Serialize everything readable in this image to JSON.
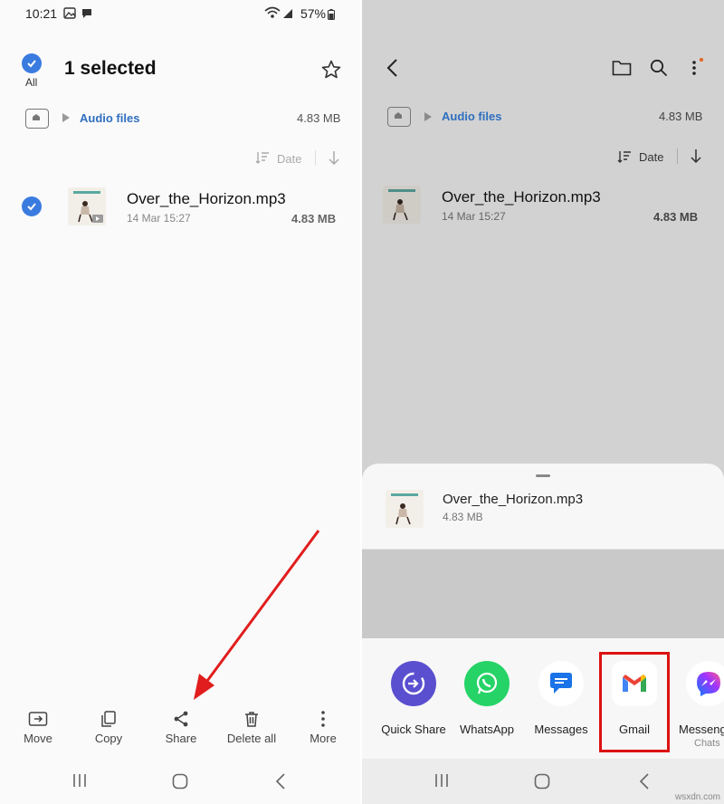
{
  "left": {
    "status": {
      "time": "10:21",
      "battery": "57%"
    },
    "header": {
      "title": "1 selected",
      "all_label": "All"
    },
    "path": {
      "folder": "Audio files",
      "size": "4.83 MB"
    },
    "sort": {
      "label": "Date"
    },
    "file": {
      "name": "Over_the_Horizon.mp3",
      "date": "14 Mar 15:27",
      "size": "4.83 MB"
    },
    "actions": [
      {
        "label": "Move",
        "icon": "move-icon"
      },
      {
        "label": "Copy",
        "icon": "copy-icon"
      },
      {
        "label": "Share",
        "icon": "share-icon"
      },
      {
        "label": "Delete all",
        "icon": "trash-icon"
      },
      {
        "label": "More",
        "icon": "more-vertical-icon"
      }
    ],
    "annotation_color": "#e11d1d"
  },
  "right": {
    "path": {
      "folder": "Audio files",
      "size": "4.83 MB"
    },
    "sort": {
      "label": "Date"
    },
    "file": {
      "name": "Over_the_Horizon.mp3",
      "date": "14 Mar 15:27",
      "size": "4.83 MB"
    },
    "sheet": {
      "file_name": "Over_the_Horizon.mp3",
      "file_size": "4.83 MB",
      "apps": [
        {
          "label": "Quick Share",
          "icon": "quick-share-icon",
          "color": "#5a4fcf"
        },
        {
          "label": "WhatsApp",
          "icon": "whatsapp-icon",
          "color": "#25d366"
        },
        {
          "label": "Messages",
          "icon": "messages-icon",
          "color": "#1a73e8"
        },
        {
          "label": "Gmail",
          "icon": "gmail-icon",
          "color": "#ea4335"
        },
        {
          "label": "Messeng",
          "sublabel": "Chats",
          "icon": "messenger-icon",
          "color": "#a033ff"
        }
      ],
      "highlight_color": "#d11111"
    }
  },
  "watermark": "wsxdn.com"
}
